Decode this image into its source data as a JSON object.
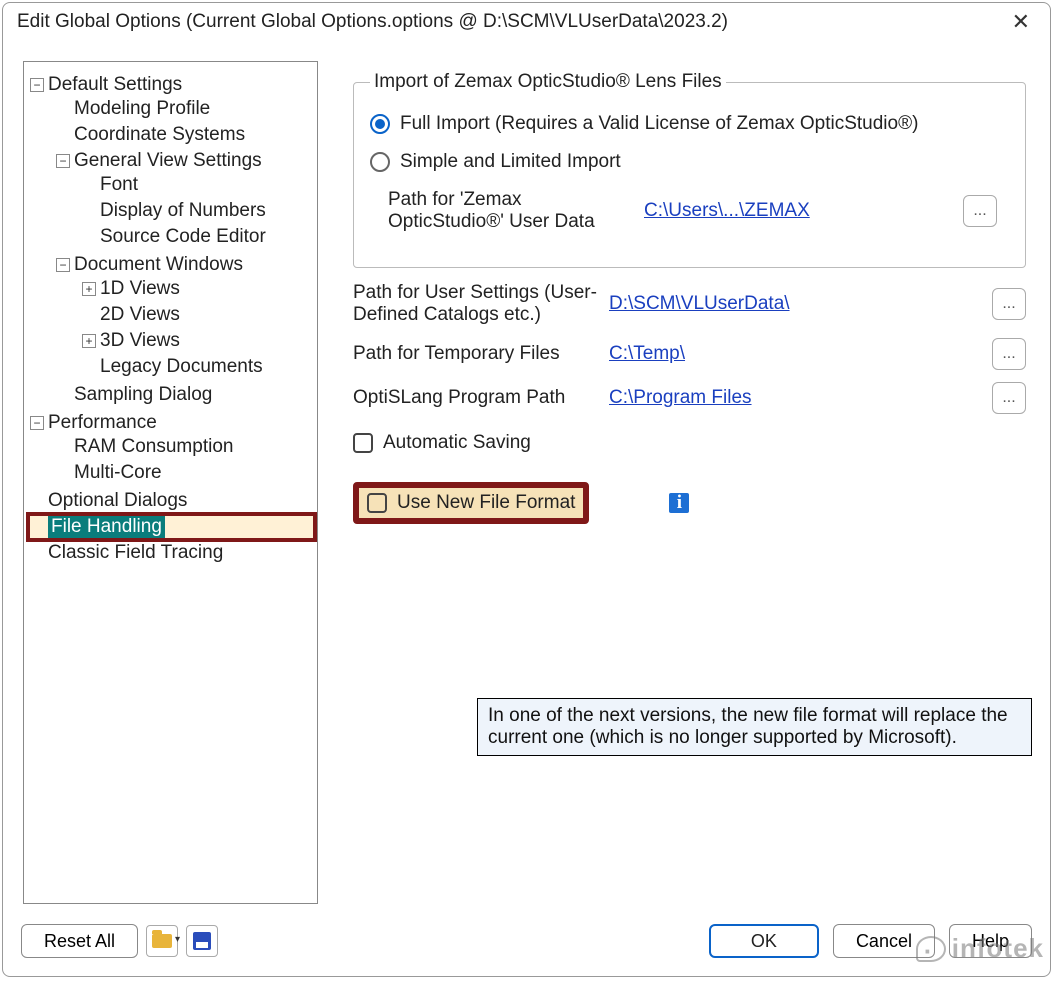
{
  "title": "Edit Global Options (Current Global Options.options @ D:\\SCM\\VLUserData\\2023.2)",
  "tree": {
    "default_settings": "Default Settings",
    "modeling_profile": "Modeling Profile",
    "coordinate_systems": "Coordinate Systems",
    "general_view_settings": "General View Settings",
    "font": "Font",
    "display_of_numbers": "Display of Numbers",
    "source_code_editor": "Source Code Editor",
    "document_windows": "Document Windows",
    "views_1d": "1D Views",
    "views_2d": "2D Views",
    "views_3d": "3D Views",
    "legacy_documents": "Legacy Documents",
    "sampling_dialog": "Sampling Dialog",
    "performance": "Performance",
    "ram_consumption": "RAM Consumption",
    "multi_core": "Multi-Core",
    "optional_dialogs": "Optional Dialogs",
    "file_handling": "File Handling",
    "classic_field_tracing": "Classic Field Tracing"
  },
  "group_legend": "Import of Zemax OpticStudio® Lens Files",
  "radio_full": "Full Import (Requires a Valid License of Zemax OpticStudio®)",
  "radio_simple": "Simple and Limited Import",
  "zemax_path_label": "Path for 'Zemax OpticStudio®' User Data",
  "zemax_path_link": "C:\\Users\\...\\ZEMAX",
  "user_settings_label": "Path for User Settings (User-Defined Catalogs etc.)",
  "user_settings_link": "D:\\SCM\\VLUserData\\",
  "temp_label": "Path for Temporary Files",
  "temp_link": "C:\\Temp\\",
  "optislang_label": "OptiSLang Program Path",
  "optislang_link": "C:\\Program Files",
  "auto_save": "Automatic Saving",
  "new_format": "Use New File Format",
  "tooltip": "In one of the next versions, the new file format will replace the current one (which is no longer supported by Microsoft).",
  "footer": {
    "reset": "Reset All",
    "ok": "OK",
    "cancel": "Cancel",
    "help": "Help"
  },
  "dots": "...",
  "info_i": "i",
  "watermark": "infotek"
}
